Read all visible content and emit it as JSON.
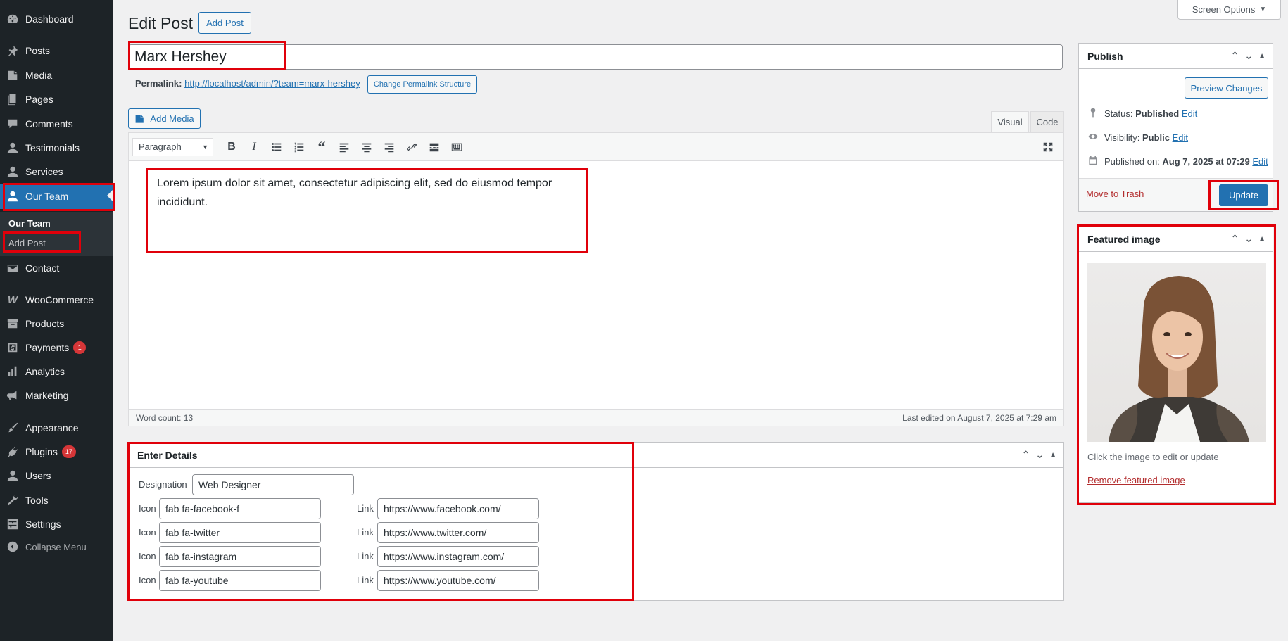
{
  "sidebar": {
    "items": [
      {
        "label": "Dashboard",
        "icon": "dashboard-icon"
      },
      {
        "label": "Posts",
        "icon": "pin-icon"
      },
      {
        "label": "Media",
        "icon": "media-icon"
      },
      {
        "label": "Pages",
        "icon": "pages-icon"
      },
      {
        "label": "Comments",
        "icon": "comment-icon"
      },
      {
        "label": "Testimonials",
        "icon": "user-icon"
      },
      {
        "label": "Services",
        "icon": "user-icon"
      },
      {
        "label": "Our Team",
        "icon": "user-icon"
      },
      {
        "label": "Contact",
        "icon": "email-icon"
      },
      {
        "label": "WooCommerce",
        "icon": "woo-icon"
      },
      {
        "label": "Products",
        "icon": "archive-icon"
      },
      {
        "label": "Payments",
        "icon": "dollar-icon",
        "badge": "1"
      },
      {
        "label": "Analytics",
        "icon": "chart-icon"
      },
      {
        "label": "Marketing",
        "icon": "megaphone-icon"
      },
      {
        "label": "Appearance",
        "icon": "brush-icon"
      },
      {
        "label": "Plugins",
        "icon": "plugin-icon",
        "badge": "17"
      },
      {
        "label": "Users",
        "icon": "user-icon"
      },
      {
        "label": "Tools",
        "icon": "wrench-icon"
      },
      {
        "label": "Settings",
        "icon": "settings-icon"
      }
    ],
    "submenu": {
      "heading": "Our Team",
      "add_post": "Add Post"
    },
    "collapse": "Collapse Menu"
  },
  "header": {
    "title": "Edit Post",
    "add_post": "Add Post",
    "screen_options": "Screen Options"
  },
  "post": {
    "title": "Marx Hershey",
    "permalink_label": "Permalink:",
    "permalink_url": "http://localhost/admin/?team=marx-hershey",
    "change_permalink": "Change Permalink Structure"
  },
  "editor": {
    "add_media": "Add Media",
    "tab_visual": "Visual",
    "tab_code": "Code",
    "format_select": "Paragraph",
    "content": "Lorem ipsum dolor sit amet, consectetur adipiscing elit, sed do eiusmod tempor incididunt.",
    "word_count": "Word count: 13",
    "last_edited": "Last edited on August 7, 2025 at 7:29 am"
  },
  "details": {
    "heading": "Enter Details",
    "designation_label": "Designation",
    "designation": "Web Designer",
    "icon_label": "Icon",
    "link_label": "Link",
    "rows": [
      {
        "icon": "fab fa-facebook-f",
        "link": "https://www.facebook.com/"
      },
      {
        "icon": "fab fa-twitter",
        "link": "https://www.twitter.com/"
      },
      {
        "icon": "fab fa-instagram",
        "link": "https://www.instagram.com/"
      },
      {
        "icon": "fab fa-youtube",
        "link": "https://www.youtube.com/"
      }
    ]
  },
  "publish": {
    "heading": "Publish",
    "preview": "Preview Changes",
    "status_label": "Status:",
    "status": "Published",
    "visibility_label": "Visibility:",
    "visibility": "Public",
    "published_label": "Published on:",
    "published": "Aug 7, 2025 at 07:29",
    "edit": "Edit",
    "trash": "Move to Trash",
    "update": "Update"
  },
  "featured": {
    "heading": "Featured image",
    "hint": "Click the image to edit or update",
    "remove": "Remove featured image"
  },
  "colors": {
    "accent": "#2271b1",
    "sidebar": "#1d2327",
    "highlight": "#e0000a"
  }
}
